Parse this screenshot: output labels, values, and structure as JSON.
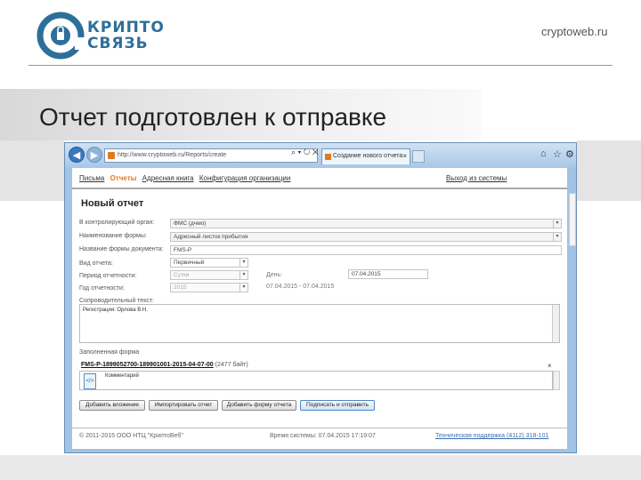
{
  "slide": {
    "logo_line1": "КРИПТО",
    "logo_line2": "СВЯЗЬ",
    "site": "cryptoweb.ru",
    "title": "Отчет подготовлен к отправке"
  },
  "browser": {
    "address": "http://www.cryptoweb.ru/Reports/create",
    "tab_title": "Создание нового отчета",
    "back_icon": "arrow-left-icon",
    "forward_icon": "arrow-right-icon"
  },
  "menu": {
    "items": [
      "Письма",
      "Отчеты",
      "Адресная книга",
      "Конфигурация организации"
    ],
    "active_index": 1,
    "logout": "Выход из системы"
  },
  "form": {
    "heading": "Новый отчет",
    "labels": {
      "organ": "В контролирующий орган:",
      "form_name": "Наименование формы:",
      "doc_form_name": "Название формы документа:",
      "report_type": "Вид отчета:",
      "period": "Период отчетности:",
      "year": "Год отчетности:",
      "day": "День:",
      "accompanying": "Сопроводительный текст:"
    },
    "values": {
      "organ": "ФМС (дчмо)",
      "form_name": "Адресный листок прибытия",
      "doc_form_name": "FMS-P",
      "report_type": "Первичный",
      "period": "Сутки",
      "year": "2015",
      "day": "07.04.2015",
      "period_range": "07.04.2015 - 07.04.2015",
      "accompanying": "Регистрация: Орлова В.Н."
    },
    "filled_label": "Заполненная форма",
    "file_name": "FMS-P-1899052700-189901001-2015-04-07-00",
    "file_size": "(2477 байт)",
    "comment": "Комментарий"
  },
  "buttons": {
    "attach": "Добавить вложение",
    "import": "Импортировать отчет",
    "add_form": "Добавить форму отчета",
    "sign_send": "Подписать и отправить"
  },
  "footer": {
    "copyright": "© 2011-2015 ООО НТЦ \"КриптоВеб\"",
    "system_time": "Время системы: 07.04.2015 17:19:07",
    "support": "Техническая поддержка (4112) 318-101"
  },
  "colors": {
    "brand": "#2d6f99",
    "accent": "#e07a1f",
    "browser_frame": "#9fc4e4"
  }
}
